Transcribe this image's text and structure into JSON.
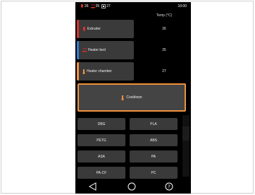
{
  "status": {
    "extruder_temp": "26",
    "bed_temp": "25",
    "chamber_temp": "27",
    "clock": "10:00"
  },
  "table": {
    "header": "Temp (°C)"
  },
  "heaters": [
    {
      "label": "Extruder",
      "temp": "26",
      "color": "#d9312d",
      "icon": "extruder-icon"
    },
    {
      "label": "Heater bed",
      "temp": "25",
      "color": "#2f7fd1",
      "icon": "heater-bed-icon"
    },
    {
      "label": "Heater chamber",
      "temp": "27",
      "color": "#f0923c",
      "icon": "chamber-icon"
    }
  ],
  "cooldown": {
    "label": "Cooldown",
    "accent": "#f0923c"
  },
  "presets": [
    "DBG",
    "PLA",
    "PETG",
    "ABS",
    "ASA",
    "PA",
    "PA-CF",
    "PC"
  ],
  "nav": {
    "back_icon": "back-triangle-icon",
    "home_icon": "home-circle-icon",
    "help_icon": "help-icon"
  }
}
